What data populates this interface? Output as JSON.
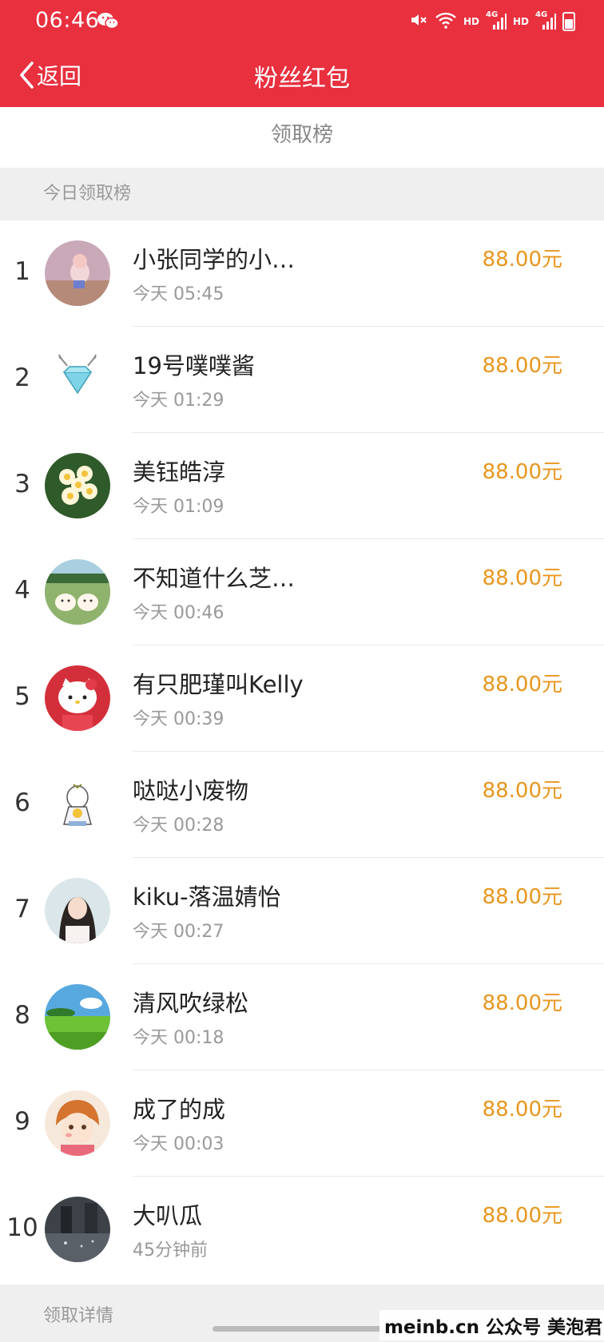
{
  "status_bar": {
    "time": "06:46",
    "hd1": "HD",
    "net1": "4G",
    "hd2": "HD",
    "net2": "4G"
  },
  "nav": {
    "back_label": "返回",
    "title": "粉丝红包"
  },
  "subtitle": "领取榜",
  "sections": {
    "today": "今日领取榜",
    "details": "领取详情"
  },
  "rows": [
    {
      "rank": "1",
      "name": "小张同学的小…",
      "time": "今天 05:45",
      "amount": "88.00元",
      "avatar_icon": "pink-photo-avatar-icon"
    },
    {
      "rank": "2",
      "name": "19号噗噗酱",
      "time": "今天 01:29",
      "amount": "88.00元",
      "avatar_icon": "diamond-antler-avatar-icon"
    },
    {
      "rank": "3",
      "name": "美钰皓淳",
      "time": "今天 01:09",
      "amount": "88.00元",
      "avatar_icon": "frangipani-flower-avatar-icon"
    },
    {
      "rank": "4",
      "name": "不知道什么芝…",
      "time": "今天 00:46",
      "amount": "88.00元",
      "avatar_icon": "cartoon-cats-avatar-icon"
    },
    {
      "rank": "5",
      "name": "有只肥瑾叫Kelly",
      "time": "今天 00:39",
      "amount": "88.00元",
      "avatar_icon": "hello-kitty-avatar-icon"
    },
    {
      "rank": "6",
      "name": "哒哒小废物",
      "time": "今天 00:28",
      "amount": "88.00元",
      "avatar_icon": "cartoon-girl-avatar-icon"
    },
    {
      "rank": "7",
      "name": "kiku-落温婧怡",
      "time": "今天 00:27",
      "amount": "88.00元",
      "avatar_icon": "portrait-girl-avatar-icon"
    },
    {
      "rank": "8",
      "name": "清风吹绿松",
      "time": "今天 00:18",
      "amount": "88.00元",
      "avatar_icon": "green-meadow-avatar-icon"
    },
    {
      "rank": "9",
      "name": "成了的成",
      "time": "今天 00:03",
      "amount": "88.00元",
      "avatar_icon": "anime-character-avatar-icon"
    },
    {
      "rank": "10",
      "name": "大叭瓜",
      "time": "45分钟前",
      "amount": "88.00元",
      "avatar_icon": "dark-street-avatar-icon"
    }
  ],
  "watermark": "meinb.cn  公众号 美泡君",
  "colors": {
    "header_red": "#e8303f",
    "amount_orange": "#e8961e",
    "section_gray": "#efefef"
  }
}
